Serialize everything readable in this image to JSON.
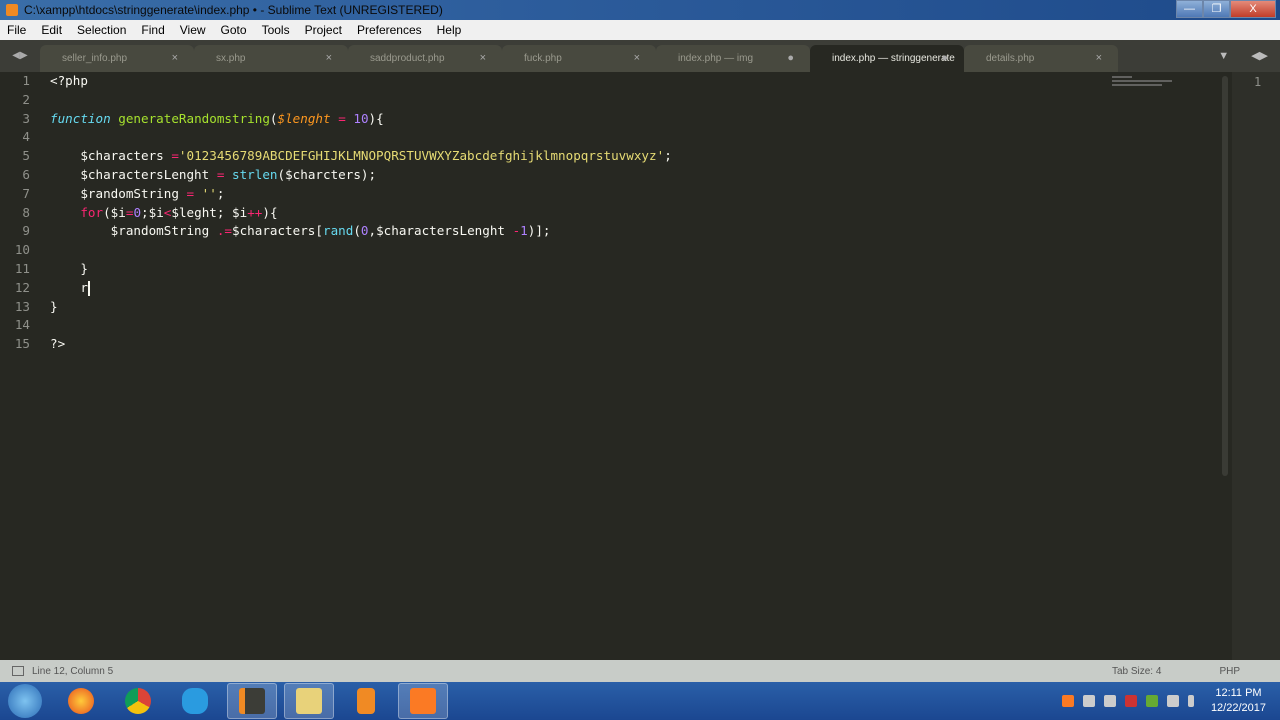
{
  "window": {
    "title": "C:\\xampp\\htdocs\\stringgenerate\\index.php • - Sublime Text (UNREGISTERED)",
    "minimize": "—",
    "restore": "❐",
    "close": "X"
  },
  "menu": [
    "File",
    "Edit",
    "Selection",
    "Find",
    "View",
    "Goto",
    "Tools",
    "Project",
    "Preferences",
    "Help"
  ],
  "tabs": [
    {
      "label": "seller_info.php",
      "mark": "×"
    },
    {
      "label": "sx.php",
      "mark": "×"
    },
    {
      "label": "saddproduct.php",
      "mark": "×"
    },
    {
      "label": "fuck.php",
      "mark": "×"
    },
    {
      "label": "index.php — img",
      "mark": "●"
    },
    {
      "label": "index.php — stringgenerate",
      "mark": "●",
      "active": true
    },
    {
      "label": "details.php",
      "mark": "×"
    }
  ],
  "tab_nav": {
    "left": "◀▶",
    "dropdown": "▼",
    "right": "◀▶"
  },
  "code_lines": [
    [
      [
        "plain",
        "<?php"
      ]
    ],
    [],
    [
      [
        "sto",
        "function"
      ],
      [
        "plain",
        " "
      ],
      [
        "fn",
        "generateRandomstring"
      ],
      [
        "plain",
        "("
      ],
      [
        "par",
        "$lenght"
      ],
      [
        "plain",
        " "
      ],
      [
        "op",
        "="
      ],
      [
        "plain",
        " "
      ],
      [
        "num",
        "10"
      ],
      [
        "plain",
        "){"
      ]
    ],
    [],
    [
      [
        "plain",
        "    $characters "
      ],
      [
        "op",
        "="
      ],
      [
        "str",
        "'0123456789ABCDEFGHIJKLMNOPQRSTUVWXYZabcdefghijklmnopqrstuvwxyz'"
      ],
      [
        "plain",
        ";"
      ]
    ],
    [
      [
        "plain",
        "    $charactersLenght "
      ],
      [
        "op",
        "="
      ],
      [
        "plain",
        " "
      ],
      [
        "bi",
        "strlen"
      ],
      [
        "plain",
        "($charcters);"
      ]
    ],
    [
      [
        "plain",
        "    $randomString "
      ],
      [
        "op",
        "="
      ],
      [
        "plain",
        " "
      ],
      [
        "str",
        "''"
      ],
      [
        "plain",
        ";"
      ]
    ],
    [
      [
        "plain",
        "    "
      ],
      [
        "kw",
        "for"
      ],
      [
        "plain",
        "($i"
      ],
      [
        "op",
        "="
      ],
      [
        "num",
        "0"
      ],
      [
        "plain",
        ";$i"
      ],
      [
        "op",
        "<"
      ],
      [
        "plain",
        "$leght; $i"
      ],
      [
        "op",
        "++"
      ],
      [
        "plain",
        "){"
      ]
    ],
    [
      [
        "plain",
        "        $randomString "
      ],
      [
        "op",
        ".="
      ],
      [
        "plain",
        "$characters["
      ],
      [
        "bi",
        "rand"
      ],
      [
        "plain",
        "("
      ],
      [
        "num",
        "0"
      ],
      [
        "plain",
        ",$charactersLenght "
      ],
      [
        "op",
        "-"
      ],
      [
        "num",
        "1"
      ],
      [
        "plain",
        ")];"
      ]
    ],
    [],
    [
      [
        "plain",
        "    }"
      ]
    ],
    [
      [
        "plain",
        "    r"
      ],
      [
        "caret",
        ""
      ]
    ],
    [
      [
        "plain",
        "}"
      ]
    ],
    [],
    [
      [
        "plain",
        "?>"
      ]
    ]
  ],
  "right_gutter_line": "1",
  "status": {
    "position": "Line 12, Column 5",
    "tab_size": "Tab Size: 4",
    "syntax": "PHP"
  },
  "taskbar": {
    "apps": [
      "windows-start",
      "firefox",
      "chrome",
      "internet-explorer",
      "sublime-text",
      "file-explorer",
      "media-player",
      "xampp"
    ],
    "active": "sublime-text",
    "time": "12:11 PM",
    "date": "12/22/2017"
  },
  "colors": {
    "editor_bg": "#272822",
    "keyword": "#f92672",
    "function": "#a6e22e",
    "string": "#e6db74",
    "number": "#ae81ff"
  }
}
